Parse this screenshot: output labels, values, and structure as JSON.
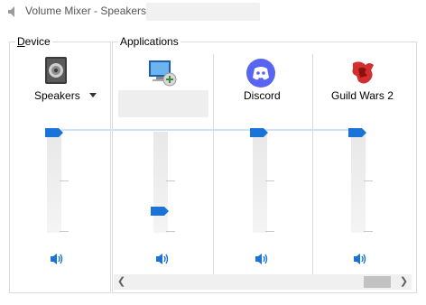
{
  "window": {
    "title": "Volume Mixer - Speakers"
  },
  "groups": {
    "device_label_accel": "D",
    "device_label_rest": "evice",
    "applications_label": "Applications"
  },
  "device": {
    "name": "Speakers",
    "icon": "speaker-icon",
    "volume_percent": 100
  },
  "applications": [
    {
      "name": "",
      "icon": "system-sounds-monitor-icon",
      "volume_percent": 15
    },
    {
      "name": "Discord",
      "icon": "discord-icon",
      "volume_percent": 100
    },
    {
      "name": "Guild Wars 2",
      "icon": "guild-wars-2-icon",
      "volume_percent": 100
    }
  ],
  "colors": {
    "accent": "#1a73d9",
    "discord": "#5865f2",
    "gw2_red": "#d32f2f"
  }
}
